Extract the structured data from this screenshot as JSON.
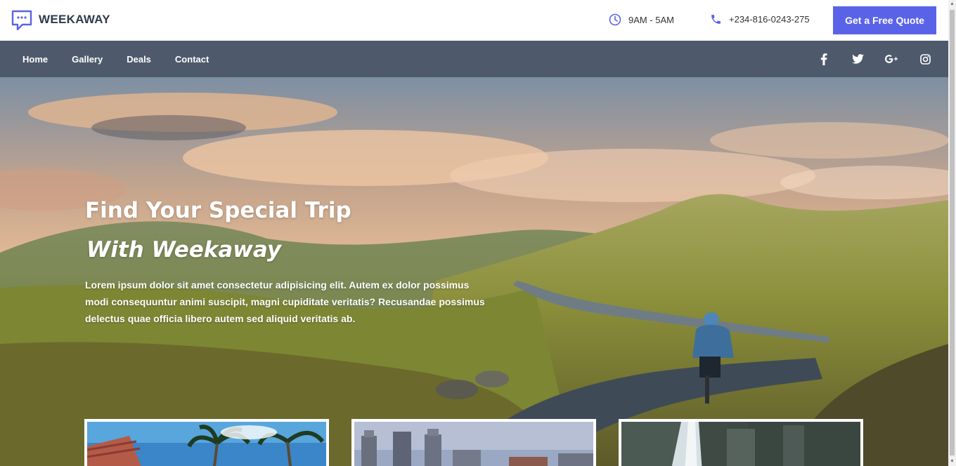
{
  "brand": {
    "name": "WEEKAWAY"
  },
  "header": {
    "hours": "9AM - 5AM",
    "phone": "+234-816-0243-275",
    "quote_button": "Get a Free Quote"
  },
  "nav": {
    "items": [
      {
        "label": "Home"
      },
      {
        "label": "Gallery"
      },
      {
        "label": "Deals"
      },
      {
        "label": "Contact"
      }
    ],
    "social": [
      "facebook-icon",
      "twitter-icon",
      "google-plus-icon",
      "instagram-icon"
    ]
  },
  "hero": {
    "title_line1": "Find Your Special Trip",
    "title_line2": "With Weekaway",
    "text": "Lorem ipsum dolor sit amet consectetur adipisicing elit. Autem ex dolor possimus modi consequuntur animi suscipit, magni cupiditate veritatis? Recusandae possimus delectus quae officia libero autem sed aliquid veritatis ab."
  },
  "colors": {
    "accent": "#5a63e8",
    "navbar": "#4e5a6c",
    "brand_text": "#2e3a4d"
  }
}
